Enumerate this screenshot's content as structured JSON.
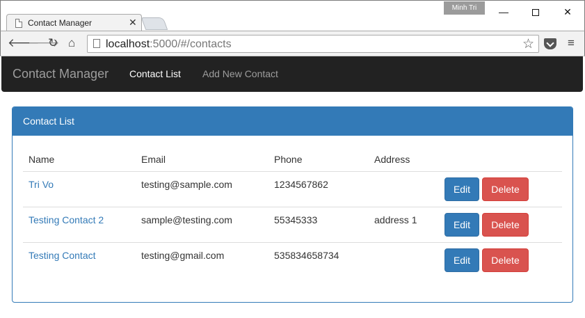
{
  "window": {
    "user": "Minh Tri",
    "minimize": "—",
    "close": "✕"
  },
  "tab": {
    "title": "Contact Manager",
    "close": "✕"
  },
  "address_bar": {
    "host": "localhost",
    "rest": ":5000/#/contacts"
  },
  "navbar": {
    "brand": "Contact Manager",
    "links": [
      "Contact List",
      "Add New Contact"
    ]
  },
  "panel": {
    "title": "Contact List"
  },
  "table": {
    "headers": [
      "Name",
      "Email",
      "Phone",
      "Address"
    ],
    "rows": [
      {
        "name": "Tri Vo",
        "email": "testing@sample.com",
        "phone": "1234567862",
        "address": ""
      },
      {
        "name": "Testing Contact 2",
        "email": "sample@testing.com",
        "phone": "55345333",
        "address": "address 1"
      },
      {
        "name": "Testing Contact",
        "email": "testing@gmail.com",
        "phone": "535834658734",
        "address": ""
      }
    ],
    "edit_label": "Edit",
    "delete_label": "Delete"
  },
  "colors": {
    "primary": "#337ab7",
    "danger": "#d9534f",
    "navbar": "#222222"
  }
}
